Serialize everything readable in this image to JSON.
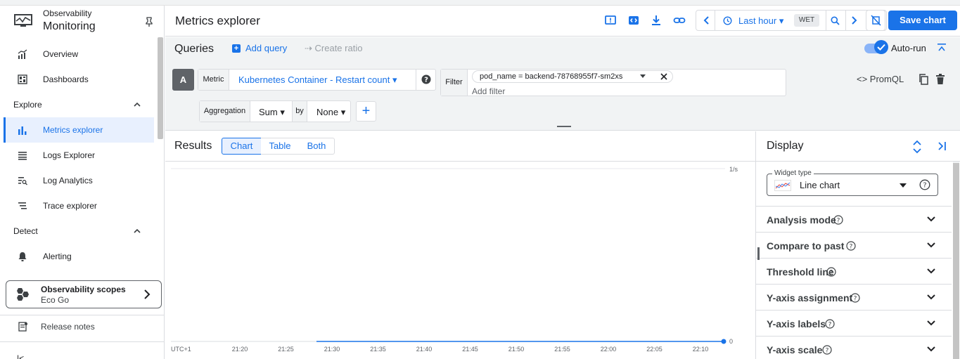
{
  "sidebar": {
    "brand_sub": "Observability",
    "brand_title": "Monitoring",
    "items": [
      {
        "label": "Overview",
        "icon": "bar-trend-icon"
      },
      {
        "label": "Dashboards",
        "icon": "dashboard-icon"
      },
      {
        "label": "Metrics explorer",
        "icon": "bar-chart-icon",
        "active": true
      },
      {
        "label": "Logs Explorer",
        "icon": "list-icon"
      },
      {
        "label": "Log Analytics",
        "icon": "log-search-icon"
      },
      {
        "label": "Trace explorer",
        "icon": "trace-icon"
      },
      {
        "label": "Alerting",
        "icon": "bell-icon"
      }
    ],
    "sections": [
      "Explore",
      "Detect"
    ],
    "scopes": {
      "title": "Observability scopes",
      "subtitle": "Eco Go"
    },
    "release_notes": "Release notes",
    "collapse_glyph": "|<"
  },
  "header": {
    "title": "Metrics explorer",
    "time_range": "Last hour",
    "timezone": "WET",
    "save_label": "Save chart"
  },
  "queries": {
    "title": "Queries",
    "add_query": "Add query",
    "create_ratio": "Create ratio",
    "autorun_label": "Auto-run",
    "autorun_on": true,
    "query_letter": "A",
    "metric_key": "Metric",
    "metric_value": "Kubernetes Container - Restart count",
    "filter_key": "Filter",
    "filter_chip": "pod_name  =  backend-78768955f7-sm2xs",
    "add_filter": "Add filter",
    "promql": "<> PromQL",
    "aggregation_key": "Aggregation",
    "aggregation_value": "Sum",
    "by_key": "by",
    "group_by_value": "None",
    "add_glyph": "+"
  },
  "results": {
    "title": "Results",
    "tabs": [
      "Chart",
      "Table",
      "Both"
    ],
    "selected_tab": "Chart"
  },
  "chart_data": {
    "type": "line",
    "ylabel": "1/s",
    "timezone_label": "UTC+1",
    "x": [
      "21:20",
      "21:25",
      "21:30",
      "21:35",
      "21:40",
      "21:45",
      "21:50",
      "21:55",
      "22:00",
      "22:05",
      "22:10"
    ],
    "series": [
      {
        "values": [
          0,
          0,
          0,
          0,
          0,
          0,
          0,
          0,
          0,
          0,
          0,
          0,
          0
        ]
      }
    ],
    "y_tick_labels": [
      "0"
    ],
    "ylim": [
      0,
      1
    ],
    "grid": true,
    "line_color": "#1a73e8"
  },
  "display": {
    "title": "Display",
    "widget_type_label": "Widget type",
    "widget_type_value": "Line chart",
    "accordions": [
      "Analysis mode",
      "Compare to past",
      "Threshold line",
      "Y-axis assignment",
      "Y-axis labels",
      "Y-axis scale"
    ]
  },
  "colors": {
    "accent": "#1a73e8",
    "panel_bg": "#f1f3f4",
    "border": "#dadce0"
  }
}
